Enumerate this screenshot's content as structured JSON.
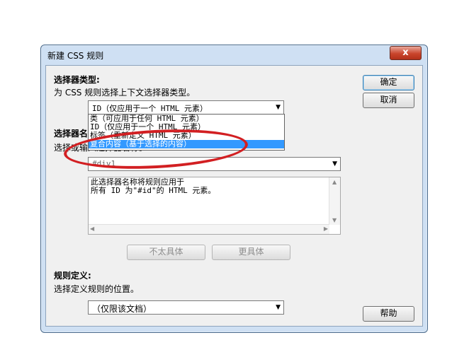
{
  "dialog": {
    "title": "新建 CSS 规则",
    "close_label": "x"
  },
  "selector_type": {
    "heading": "选择器类型:",
    "description": "为 CSS 规则选择上下文选择器类型。",
    "selected": "ID（仅应用于一个 HTML 元素）",
    "options": [
      "类（可应用于任何 HTML 元素）",
      "ID（仅应用于一个 HTML 元素）",
      "标签（重新定义 HTML 元素）",
      "复合内容（基于选择的内容）"
    ]
  },
  "selector_name": {
    "heading": "选择器名称:",
    "description": "选择或输入选择器名称。",
    "value": "#div1",
    "info_text": "此选择器名称将规则应用于\n所有 ID 为\"#id\"的 HTML 元素。",
    "less_specific": "不太具体",
    "more_specific": "更具体"
  },
  "rule_definition": {
    "heading": "规则定义:",
    "description": "选择定义规则的位置。",
    "selected": "（仅限该文档）"
  },
  "buttons": {
    "ok": "确定",
    "cancel": "取消",
    "help": "帮助"
  },
  "annotation_color": "#d21f22"
}
